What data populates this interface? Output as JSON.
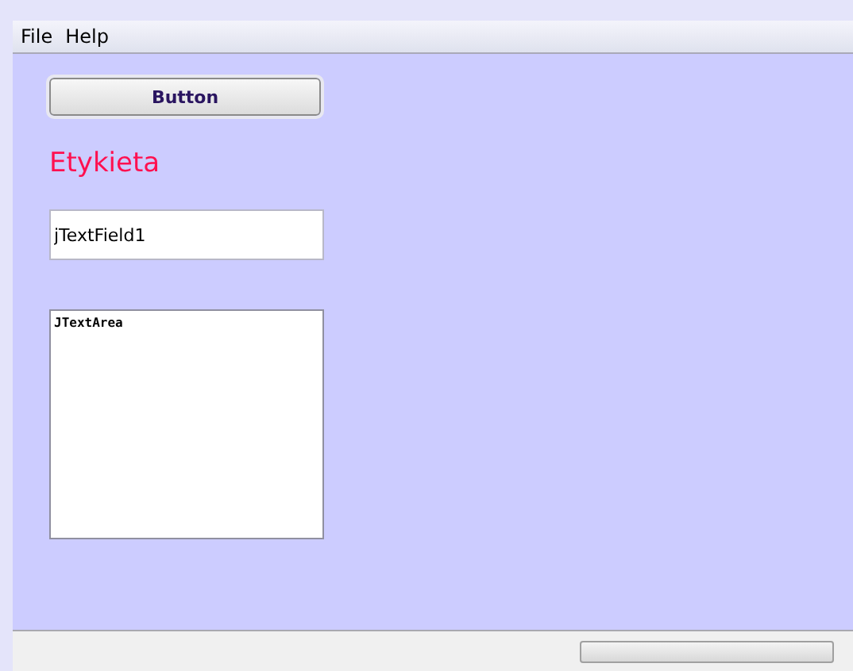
{
  "menu": [
    "File",
    "Help"
  ],
  "button": {
    "label": "Button"
  },
  "label": "Etykieta",
  "text_field": {
    "value": "jTextField1"
  },
  "text_area": {
    "value": "JTextArea"
  },
  "progress": {
    "level": 0
  }
}
